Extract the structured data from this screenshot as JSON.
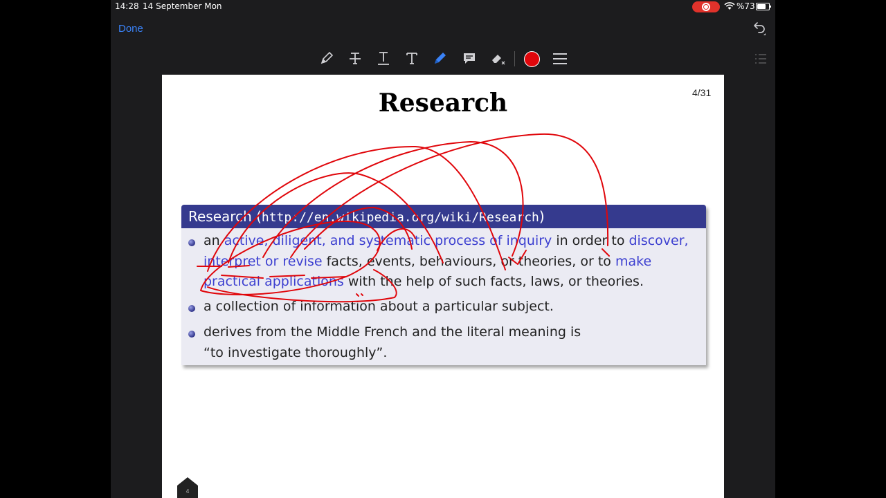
{
  "status": {
    "time": "14:28",
    "date": "14 September Mon",
    "battery": "%73"
  },
  "nav": {
    "done_label": "Done"
  },
  "toolbar": {
    "tools": [
      "pencil-tool-icon",
      "strikethrough-text-icon",
      "underline-text-icon",
      "text-icon",
      "pen-icon",
      "comment-icon",
      "eraser-icon"
    ],
    "active_color": "#e0060b"
  },
  "slide": {
    "title": "Research",
    "page": "4/31",
    "block_title_prefix": "Research (",
    "block_title_url": "http://en.wikipedia.org/wiki/Research",
    "block_title_suffix": ")",
    "bullet1_a": "an ",
    "bullet1_b": "active, diligent, and systematic process of inquiry",
    "bullet1_c": " in order to ",
    "bullet1_d": "discover, interpret or revise",
    "bullet1_e": " facts, events, behaviours, or theories, or to ",
    "bullet1_f": "make practical applications",
    "bullet1_g": " with the help of such facts, laws, or theories.",
    "bullet2": "a collection of information about a particular subject.",
    "bullet3_line1": "derives from the Middle French and the literal meaning is",
    "bullet3_line2": "“to investigate thoroughly”."
  },
  "colors": {
    "accent_blue": "#3a82f7",
    "block_header": "#353a8e",
    "ink_red": "#e0060b"
  }
}
